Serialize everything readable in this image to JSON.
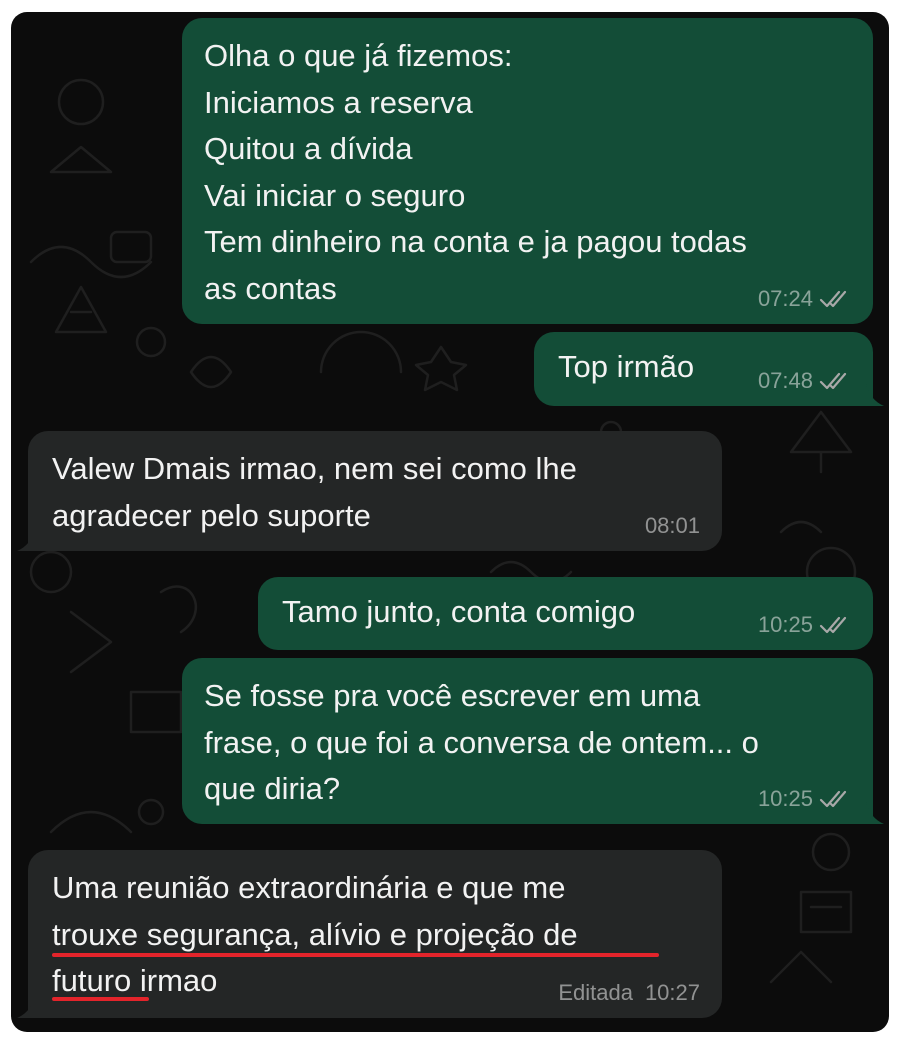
{
  "colors": {
    "background": "#0c0c0c",
    "outgoing_bubble": "#134d37",
    "incoming_bubble": "#242626",
    "message_text": "#f2f2f2",
    "meta_text": "#a8a8a8",
    "highlight_underline": "#e3242b"
  },
  "messages": [
    {
      "direction": "outgoing",
      "text": "Olha o que já fizemos:\nIniciamos a reserva\nQuitou a dívida\nVai iniciar o seguro\nTem dinheiro na conta e ja pagou todas\nas contas",
      "time": "07:24",
      "status": "read-double-check-icon"
    },
    {
      "direction": "outgoing",
      "text": "Top irmão",
      "time": "07:48",
      "status": "read-double-check-icon"
    },
    {
      "direction": "incoming",
      "text": "Valew Dmais irmao, nem sei como lhe\nagradecer pelo suporte",
      "time": "08:01"
    },
    {
      "direction": "outgoing",
      "text": "Tamo junto, conta comigo",
      "time": "10:25",
      "status": "read-double-check-icon"
    },
    {
      "direction": "outgoing",
      "text": "Se fosse pra você escrever em uma\nfrase, o que foi a conversa de ontem... o\nque diria?",
      "time": "10:25",
      "status": "read-double-check-icon"
    },
    {
      "direction": "incoming",
      "text": "Uma reunião extraordinária e que me\ntrouxe segurança, alívio e projeção de\nfuturo irmao",
      "edited_label": "Editada",
      "time": "10:27"
    }
  ]
}
